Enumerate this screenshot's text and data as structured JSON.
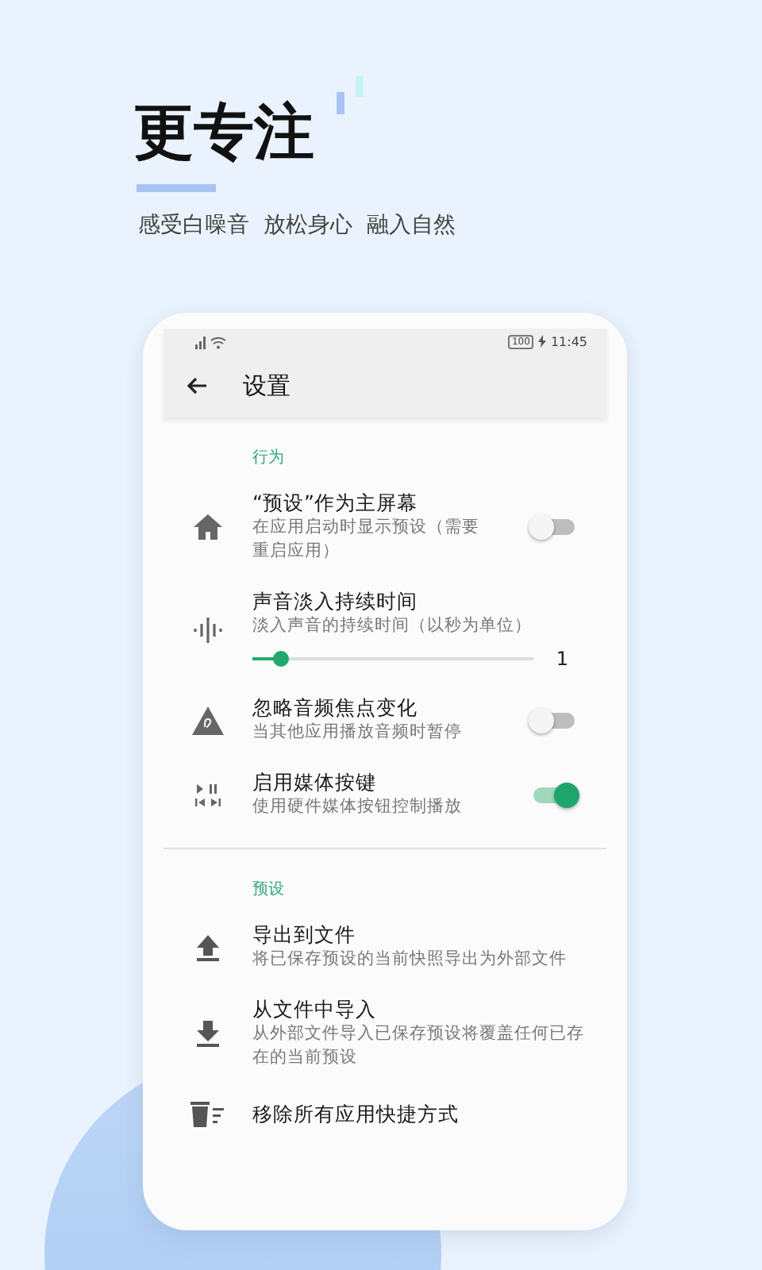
{
  "headline": "更专注",
  "tagline": "感受白噪音  放松身心  融入自然",
  "status_bar": {
    "battery": "100",
    "time": "11:45"
  },
  "toolbar": {
    "title": "设置"
  },
  "sections": [
    {
      "title": "行为",
      "items": [
        {
          "kind": "toggle",
          "title": "“预设”作为主屏幕",
          "subtitle": "在应用启动时显示预设（需要重启应用）",
          "on": false
        },
        {
          "kind": "slider",
          "title": "声音淡入持续时间",
          "subtitle": "淡入声音的持续时间（以秒为单位）",
          "level": 0.1,
          "reading": "1"
        },
        {
          "kind": "toggle",
          "title": "忽略音频焦点变化",
          "subtitle": "当其他应用播放音频时暂停",
          "on": false
        },
        {
          "kind": "toggle",
          "title": "启用媒体按键",
          "subtitle": "使用硬件媒体按钮控制播放",
          "on": true
        }
      ]
    },
    {
      "title": "预设",
      "items": [
        {
          "kind": "plain",
          "title": "导出到文件",
          "subtitle": "将已保存预设的当前快照导出为外部文件"
        },
        {
          "kind": "plain",
          "title": "从文件中导入",
          "subtitle": "从外部文件导入已保存预设将覆盖任何已存在的当前预设"
        },
        {
          "kind": "plain",
          "title": "移除所有应用快捷方式"
        }
      ]
    }
  ]
}
